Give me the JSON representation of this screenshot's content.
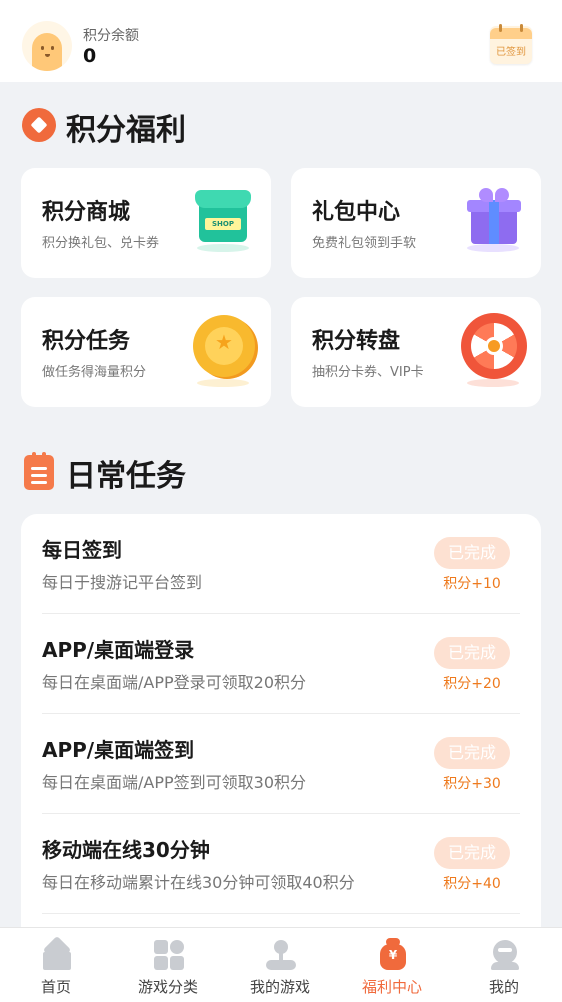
{
  "header": {
    "balance_label": "积分余额",
    "balance_value": "0",
    "signin_badge": "已签到"
  },
  "welfare": {
    "title": "积分福利",
    "cards": [
      {
        "title": "积分商城",
        "subtitle": "积分换礼包、兑卡券",
        "icon": "shop-icon",
        "sign": "SHOP"
      },
      {
        "title": "礼包中心",
        "subtitle": "免费礼包领到手软",
        "icon": "gift-icon"
      },
      {
        "title": "积分任务",
        "subtitle": "做任务得海量积分",
        "icon": "coin-icon"
      },
      {
        "title": "积分转盘",
        "subtitle": "抽积分卡券、VIP卡",
        "icon": "wheel-icon"
      }
    ]
  },
  "daily": {
    "title": "日常任务",
    "tasks": [
      {
        "title": "每日签到",
        "desc": "每日于搜游记平台签到",
        "status": "已完成",
        "points": "积分+10"
      },
      {
        "title": "APP/桌面端登录",
        "desc": "每日在桌面端/APP登录可领取20积分",
        "status": "已完成",
        "points": "积分+20"
      },
      {
        "title": "APP/桌面端签到",
        "desc": "每日在桌面端/APP签到可领取30积分",
        "status": "已完成",
        "points": "积分+30"
      },
      {
        "title": "移动端在线30分钟",
        "desc": "每日在移动端累计在线30分钟可领取40积分",
        "status": "已完成",
        "points": "积分+40"
      }
    ]
  },
  "nav": {
    "items": [
      {
        "label": "首页",
        "icon": "home-icon"
      },
      {
        "label": "游戏分类",
        "icon": "category-icon"
      },
      {
        "label": "我的游戏",
        "icon": "joystick-icon"
      },
      {
        "label": "福利中心",
        "icon": "money-bag-icon",
        "active": true
      },
      {
        "label": "我的",
        "icon": "profile-icon"
      }
    ]
  },
  "colors": {
    "accent": "#f06a3c",
    "points": "#ee7a1e",
    "done_button": "#fde1d2",
    "background": "#f0f2f5"
  }
}
